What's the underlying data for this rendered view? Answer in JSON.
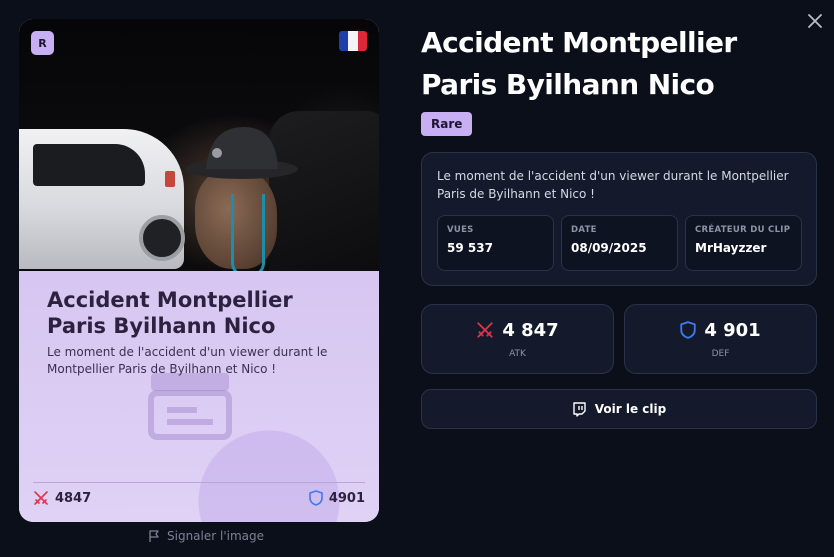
{
  "card": {
    "rarity_letter": "R",
    "flag": "france-flag-icon",
    "title": "Accident Montpellier Paris Byilhann Nico",
    "description": "Le moment de l'accident d'un viewer durant le Montpellier Paris de Byilhann et Nico !",
    "atk": "4847",
    "def": "4901"
  },
  "report_label": "Signaler l'image",
  "detail": {
    "title": "Accident Montpellier Paris Byilhann Nico",
    "rarity": "Rare",
    "description": "Le moment de l'accident d'un viewer durant le Montpellier Paris de Byilhann et Nico !",
    "meta": [
      {
        "label": "VUES",
        "value": "59 537"
      },
      {
        "label": "DATE",
        "value": "08/09/2025"
      },
      {
        "label": "CRÉATEUR DU CLIP",
        "value": "MrHayzzer"
      }
    ],
    "atk": {
      "value": "4 847",
      "label": "ATK"
    },
    "def": {
      "value": "4 901",
      "label": "DEF"
    },
    "clip_button": "Voir le clip"
  },
  "colors": {
    "rarity": "#c8aef2",
    "atk_icon": "#e0344d",
    "def_icon": "#3d7bf0",
    "background": "#0b0f1a",
    "panel": "#141a2b"
  },
  "icons": [
    "close-icon",
    "swords-icon",
    "shield-icon",
    "flag-icon",
    "twitch-icon",
    "clapperboard-icon"
  ]
}
